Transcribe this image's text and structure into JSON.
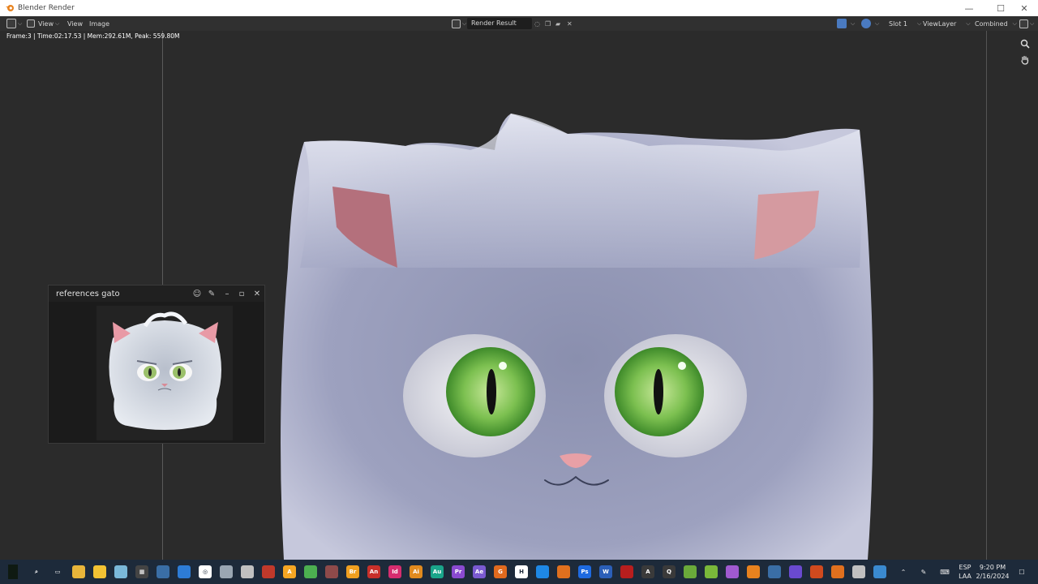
{
  "window": {
    "title": "Blender Render"
  },
  "header": {
    "menu": [
      "View",
      "View",
      "Image"
    ],
    "image_name": "Render Result",
    "slot": "Slot 1",
    "view_layer": "ViewLayer",
    "pass": "Combined"
  },
  "stats": {
    "text": "Frame:3 | Time:02:17.53 | Mem:292.61M, Peak: 559.80M"
  },
  "reference_window": {
    "title": "references gato"
  },
  "taskbar": {
    "apps": [
      {
        "name": "search",
        "color": "#1d2a3a",
        "label": "⌕"
      },
      {
        "name": "task-view",
        "color": "#1d2a3a",
        "label": "▭"
      },
      {
        "name": "file-explorer",
        "color": "#e8b53a",
        "label": ""
      },
      {
        "name": "sticky-notes",
        "color": "#f2c233",
        "label": ""
      },
      {
        "name": "app-5",
        "color": "#7ab8d9",
        "label": ""
      },
      {
        "name": "calculator",
        "color": "#444444",
        "label": "▦"
      },
      {
        "name": "app-7",
        "color": "#3a6ea5",
        "label": ""
      },
      {
        "name": "app-8",
        "color": "#2d7cd6",
        "label": ""
      },
      {
        "name": "app-9",
        "color": "#ffffff",
        "label": "◎"
      },
      {
        "name": "app-10",
        "color": "#9aa6b2",
        "label": ""
      },
      {
        "name": "app-11",
        "color": "#c0c0c0",
        "label": ""
      },
      {
        "name": "app-12",
        "color": "#c0392b",
        "label": ""
      },
      {
        "name": "app-13",
        "color": "#f5a623",
        "label": "A"
      },
      {
        "name": "app-14",
        "color": "#4caf50",
        "label": ""
      },
      {
        "name": "app-15",
        "color": "#8e4a4a",
        "label": ""
      },
      {
        "name": "bridge",
        "color": "#f0a020",
        "label": "Br"
      },
      {
        "name": "animate",
        "color": "#c8302a",
        "label": "An"
      },
      {
        "name": "indesign",
        "color": "#d62d6f",
        "label": "Id"
      },
      {
        "name": "illustrator",
        "color": "#e08a1e",
        "label": "Ai"
      },
      {
        "name": "audition",
        "color": "#1aa58a",
        "label": "Au"
      },
      {
        "name": "premiere",
        "color": "#8a4ad0",
        "label": "Pr"
      },
      {
        "name": "after-effects",
        "color": "#7a5ad0",
        "label": "Ae"
      },
      {
        "name": "app-23",
        "color": "#e06a1e",
        "label": "G"
      },
      {
        "name": "app-24",
        "color": "#ffffff",
        "label": "H"
      },
      {
        "name": "vscode",
        "color": "#1e88e5",
        "label": ""
      },
      {
        "name": "app-26",
        "color": "#e0701e",
        "label": ""
      },
      {
        "name": "photoshop",
        "color": "#1e6ae0",
        "label": "Ps"
      },
      {
        "name": "word",
        "color": "#2b5fb8",
        "label": "W"
      },
      {
        "name": "flash",
        "color": "#b81e1e",
        "label": ""
      },
      {
        "name": "app-30",
        "color": "#3a3a3a",
        "label": "A"
      },
      {
        "name": "app-31",
        "color": "#3a3a3a",
        "label": "Q"
      },
      {
        "name": "app-32",
        "color": "#6aaa3a",
        "label": ""
      },
      {
        "name": "app-33",
        "color": "#7ab83a",
        "label": ""
      },
      {
        "name": "app-34",
        "color": "#a05ad0",
        "label": ""
      },
      {
        "name": "blender",
        "color": "#e8821e",
        "label": ""
      },
      {
        "name": "app-36",
        "color": "#3a6ea5",
        "label": ""
      },
      {
        "name": "app-37",
        "color": "#6a4ad0",
        "label": ""
      },
      {
        "name": "powerpoint",
        "color": "#d04a1e",
        "label": ""
      },
      {
        "name": "app-39",
        "color": "#e0701e",
        "label": ""
      },
      {
        "name": "app-40",
        "color": "#c0c0c0",
        "label": ""
      },
      {
        "name": "photos",
        "color": "#3a8ad0",
        "label": ""
      }
    ],
    "language_1": "ESP",
    "language_2": "LAA",
    "time": "9:20 PM",
    "date": "2/16/2024"
  }
}
